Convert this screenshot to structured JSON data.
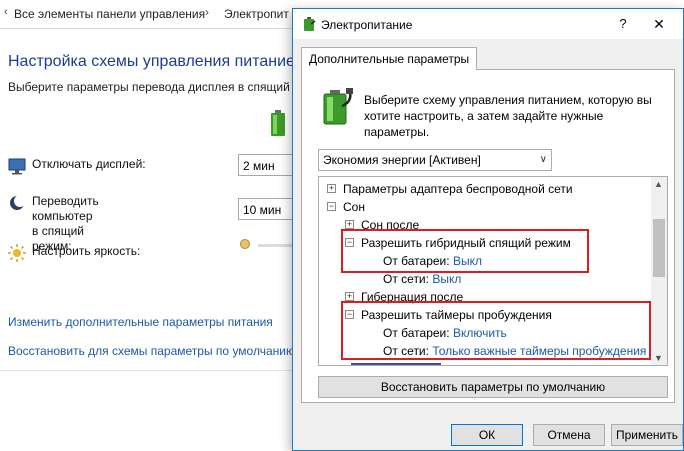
{
  "background": {
    "breadcrumb": [
      "Все элементы панели управления",
      "Электропит"
    ],
    "title": "Настройка схемы управления питанием",
    "subtitle": "Выберите параметры перевода дисплея в спящий р",
    "settings": [
      {
        "label": "Отключать дисплей:",
        "value": "2 мин"
      },
      {
        "label": "Переводить компьютер в спящий\nрежим:",
        "value": "10 мин"
      },
      {
        "label": "Настроить яркость:"
      }
    ],
    "links": [
      "Изменить дополнительные параметры питания",
      "Восстановить для схемы параметры по умолчанию"
    ]
  },
  "dialog": {
    "title": "Электропитание",
    "help": "?",
    "close": "✕",
    "tab": "Дополнительные параметры",
    "description": "Выберите схему управления питанием, которую вы хотите настроить, а затем задайте нужные параметры.",
    "scheme": "Экономия энергии [Активен]",
    "tree": [
      {
        "sign": "+",
        "text": "Параметры адаптера беспроводной сети"
      },
      {
        "sign": "−",
        "text": "Сон"
      },
      {
        "sign": "+",
        "text": "Сон после"
      },
      {
        "sign": "−",
        "text": "Разрешить гибридный спящий режим"
      },
      {
        "key": "От батареи:",
        "value": "Выкл"
      },
      {
        "key": "От сети:",
        "value": "Выкл"
      },
      {
        "sign": "+",
        "text": "Гибернация после"
      },
      {
        "sign": "−",
        "text": "Разрешить таймеры пробуждения"
      },
      {
        "key": "От батареи:",
        "value": "Включить"
      },
      {
        "key": "От сети:",
        "value": "Только важные таймеры пробуждения"
      }
    ],
    "restore_label": "Восстановить параметры по умолчанию",
    "ok_label": "ОК",
    "cancel_label": "Отмена",
    "apply_label": "Применить"
  },
  "colors": {
    "highlight": "#d81f26",
    "link": "#1a5aa8",
    "accent": "#0078d7"
  },
  "icons": [
    "chevron-left-icon",
    "battery-icon",
    "monitor-icon",
    "sleep-moon-icon",
    "brightness-icon",
    "power-options-icon"
  ]
}
